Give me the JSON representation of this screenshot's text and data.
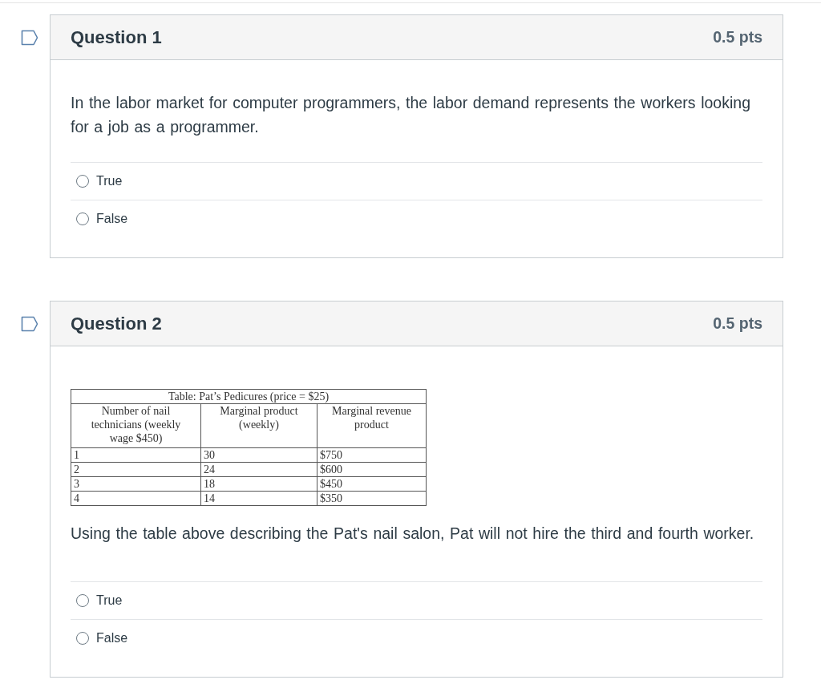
{
  "questions": [
    {
      "title": "Question 1",
      "points": "0.5 pts",
      "flagged": false,
      "text": "In the labor market for computer programmers, the labor demand represents the workers looking for a job as a programmer.",
      "answers": [
        {
          "label": "True",
          "selected": false
        },
        {
          "label": "False",
          "selected": false
        }
      ]
    },
    {
      "title": "Question 2",
      "points": "0.5 pts",
      "flagged": false,
      "table": {
        "caption": "Table: Pat’s Pedicures (price = $25)",
        "columns": [
          "Number of nail technicians (weekly wage $450)",
          "Marginal product (weekly)",
          "Marginal revenue product"
        ],
        "rows": [
          [
            "1",
            "30",
            "$750"
          ],
          [
            "2",
            "24",
            "$600"
          ],
          [
            "3",
            "18",
            "$450"
          ],
          [
            "4",
            "14",
            "$350"
          ]
        ]
      },
      "text": "Using the table above describing the Pat's nail salon, Pat will not hire the third and fourth worker.",
      "answers": [
        {
          "label": "True",
          "selected": false
        },
        {
          "label": "False",
          "selected": false
        }
      ]
    }
  ]
}
